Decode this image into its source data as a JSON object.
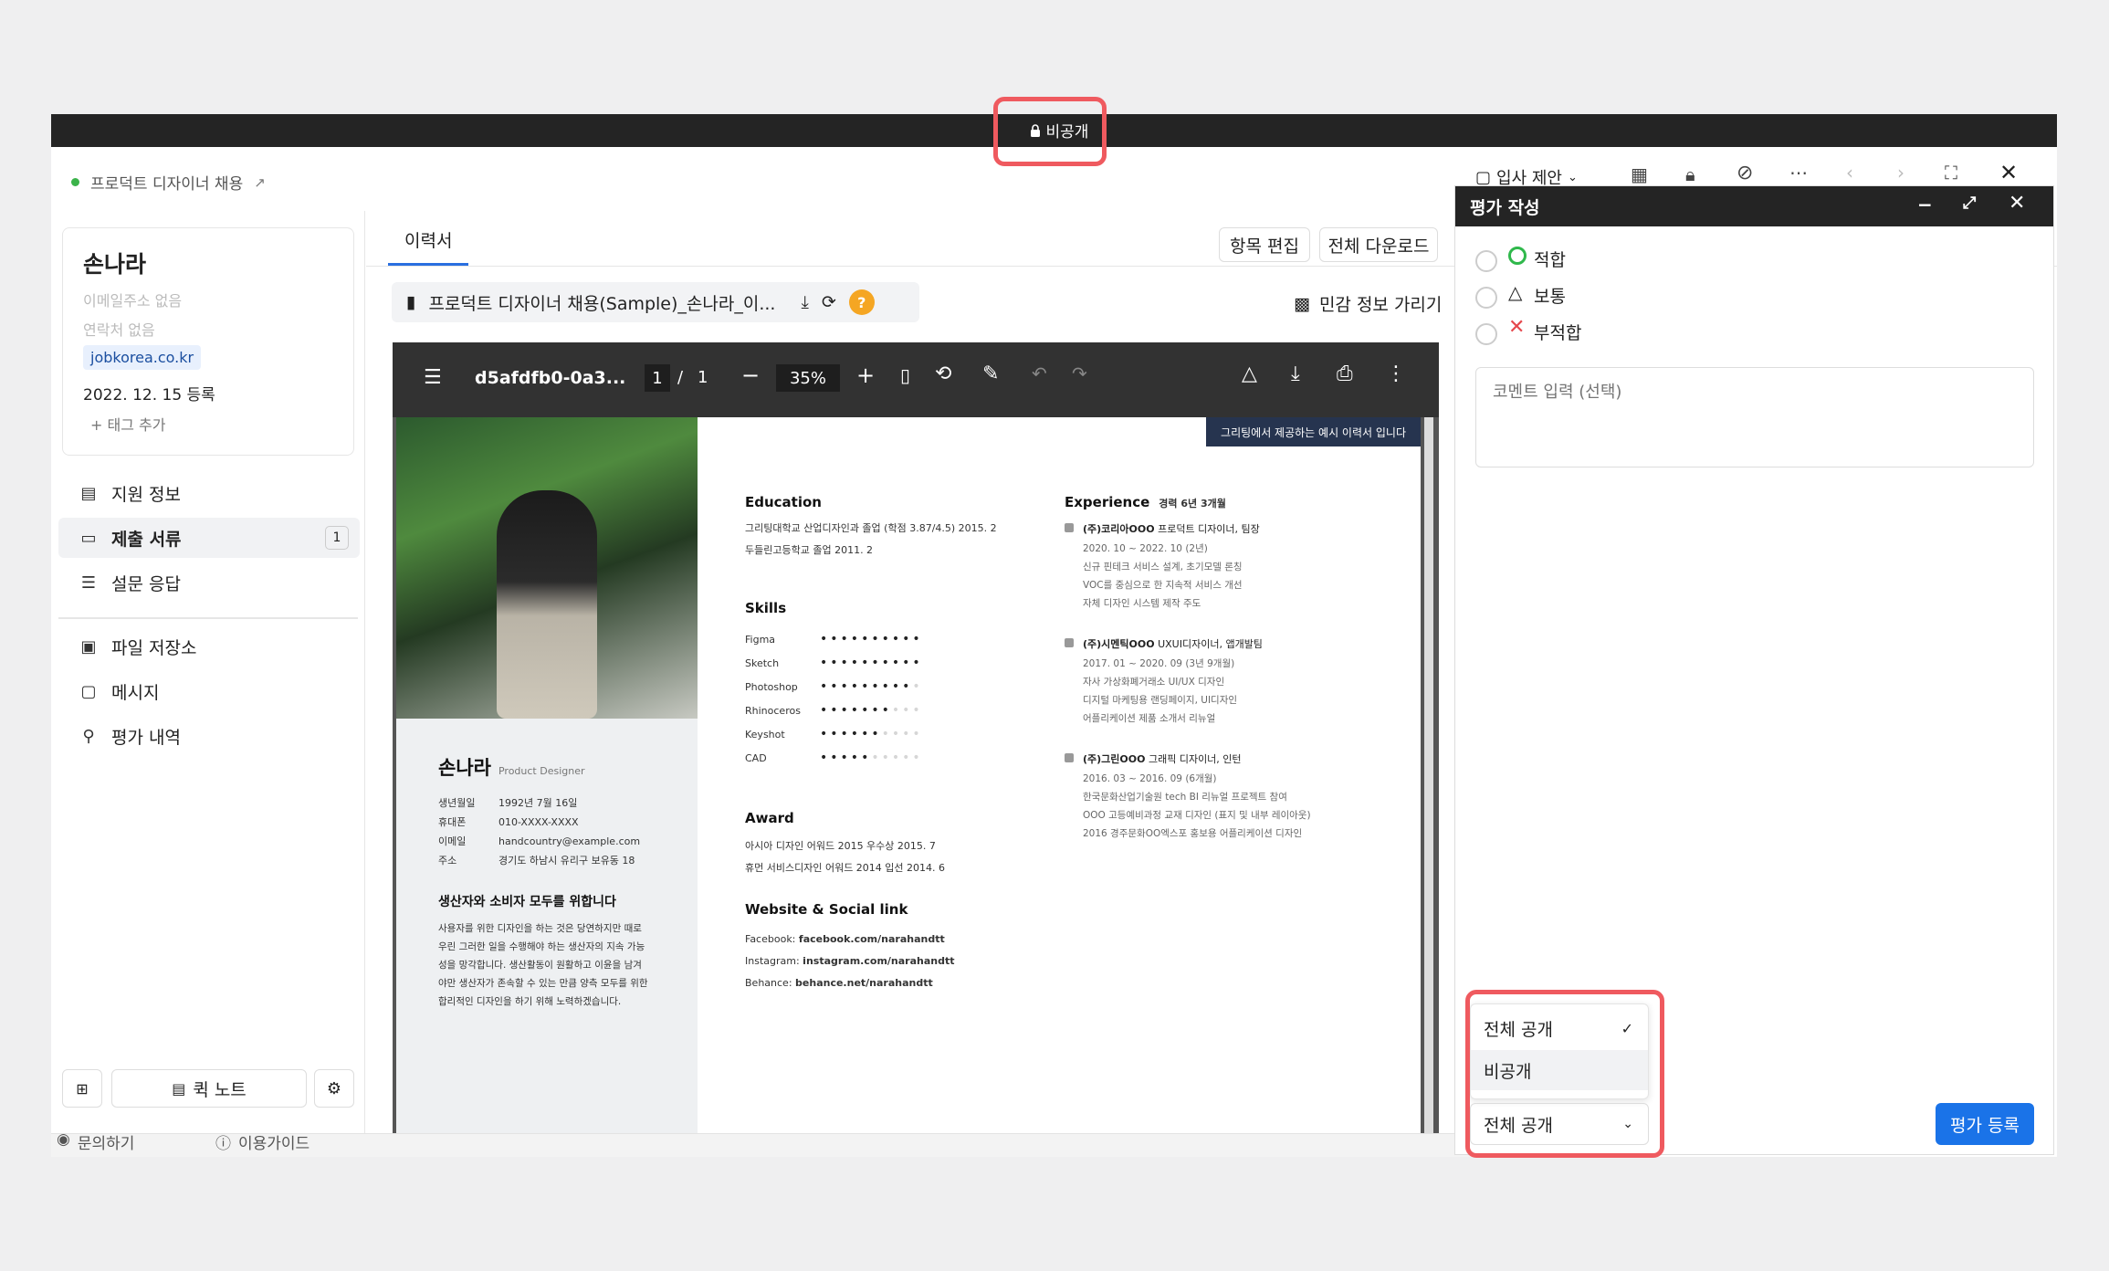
{
  "window": {
    "visibility_badge": "비공개"
  },
  "header": {
    "job_title": "프로덕트 디자이너 채용",
    "offer_label": "입사 제안"
  },
  "candidate": {
    "name": "손나라",
    "email": "이메일주소 없음",
    "phone": "연락처 없음",
    "source": "jobkorea.co.kr",
    "registered": "2022. 12. 15 등록",
    "add_tag": "+ 태그 추가"
  },
  "sidebar": {
    "items": [
      {
        "label": "지원 정보"
      },
      {
        "label": "제출 서류",
        "count": "1"
      },
      {
        "label": "설문 응답"
      },
      {
        "label": "파일 저장소"
      },
      {
        "label": "메시지"
      },
      {
        "label": "평가 내역"
      }
    ],
    "quick_note": "퀵 노트"
  },
  "footer": {
    "contact": "문의하기",
    "guide": "이용가이드"
  },
  "content": {
    "tab": "이력서",
    "edit_items": "항목 편집",
    "download_all": "전체 다운로드",
    "file_name": "프로덕트 디자이너 채용(Sample)_손나라_이...",
    "hide_sensitive": "민감 정보 가리기"
  },
  "pdf_toolbar": {
    "doc_name": "d5afdfb0-0a3...",
    "page_current": "1",
    "page_sep": "/",
    "page_total": "1",
    "zoom": "35%"
  },
  "resume": {
    "banner": "그리팅에서 제공하는 예시 이력서 입니다",
    "name": "손나라",
    "role": "Product Designer",
    "info": [
      {
        "k": "생년월일",
        "v": "1992년 7월 16일"
      },
      {
        "k": "휴대폰",
        "v": "010-XXXX-XXXX"
      },
      {
        "k": "이메일",
        "v": "handcountry@example.com"
      },
      {
        "k": "주소",
        "v": "경기도 하남시 유리구 보유동 18"
      }
    ],
    "motto_title": "생산자와 소비자 모두를 위합니다",
    "motto_lines": [
      "사용자를 위한 디자인을 하는 것은 당연하지만 때로",
      "우린 그러한 일을 수행해야 하는 생산자의 지속 가능",
      "성을 망각합니다. 생산활동이 원활하고 이윤을 남겨",
      "야만 생산자가 존속할 수 있는 만큼 양측 모두를 위한",
      "합리적인 디자인을 하기 위해 노력하겠습니다."
    ],
    "education_title": "Education",
    "education": [
      "그리팅대학교 산업디자인과 졸업 (학점 3.87/4.5)  2015. 2",
      "두들린고등학교 졸업  2011. 2"
    ],
    "skills_title": "Skills",
    "skills": [
      {
        "name": "Figma",
        "level": 10
      },
      {
        "name": "Sketch",
        "level": 10
      },
      {
        "name": "Photoshop",
        "level": 9
      },
      {
        "name": "Rhinoceros",
        "level": 7
      },
      {
        "name": "Keyshot",
        "level": 6
      },
      {
        "name": "CAD",
        "level": 5
      }
    ],
    "award_title": "Award",
    "awards": [
      "아시아 디자인 어워드 2015 우수상  2015. 7",
      "휴먼 서비스디자인 어워드 2014 입선  2014. 6"
    ],
    "links_title": "Website & Social link",
    "links": [
      {
        "k": "Facebook:",
        "v": "facebook.com/narahandtt"
      },
      {
        "k": "Instagram:",
        "v": "instagram.com/narahandtt"
      },
      {
        "k": "Behance:",
        "v": "behance.net/narahandtt"
      }
    ],
    "experience_title": "Experience",
    "experience_total": "경력 6년 3개월",
    "experience": [
      {
        "company": "(주)코리아OOO",
        "role": "프로덕트 디자이너, 팀장",
        "period": "2020. 10 ~ 2022. 10 (2년)",
        "lines": [
          "신규 핀테크 서비스 설계, 초기모델 론칭",
          "VOC를 중심으로 한 지속적 서비스 개선",
          "자체 디자인 시스템 제작 주도"
        ]
      },
      {
        "company": "(주)시멘틱OOO",
        "role": "UXUI디자이너, 앱개발팀",
        "period": "2017. 01 ~ 2020. 09 (3년 9개월)",
        "lines": [
          "자사 가상화폐거래소 UI/UX 디자인",
          "디지털 마케팅용 랜딩페이지, UI디자인",
          "어플리케이션 제품 소개서 리뉴얼"
        ]
      },
      {
        "company": "(주)그린OOO",
        "role": "그래픽 디자이너, 인턴",
        "period": "2016. 03 ~ 2016. 09 (6개월)",
        "lines": [
          "한국문화산업기술원 tech BI 리뉴얼 프로젝트 참여",
          "OOO 고등예비과정 교재 디자인 (표지 및 내부 레이아웃)",
          "2016 경주문화OO엑스포 홍보용 어플리케이션 디자인"
        ]
      }
    ]
  },
  "eval_panel": {
    "title": "평가 작성",
    "options": [
      {
        "label": "적합",
        "color": "#2fb84b"
      },
      {
        "label": "보통",
        "color": "#222222"
      },
      {
        "label": "부적합",
        "color": "#e5484d"
      }
    ],
    "comment_placeholder": "코멘트 입력 (선택)",
    "visibility_options": [
      "전체 공개",
      "비공개"
    ],
    "visibility_selected": "전체 공개",
    "submit": "평가 등록",
    "accent": "#1a73e8"
  }
}
